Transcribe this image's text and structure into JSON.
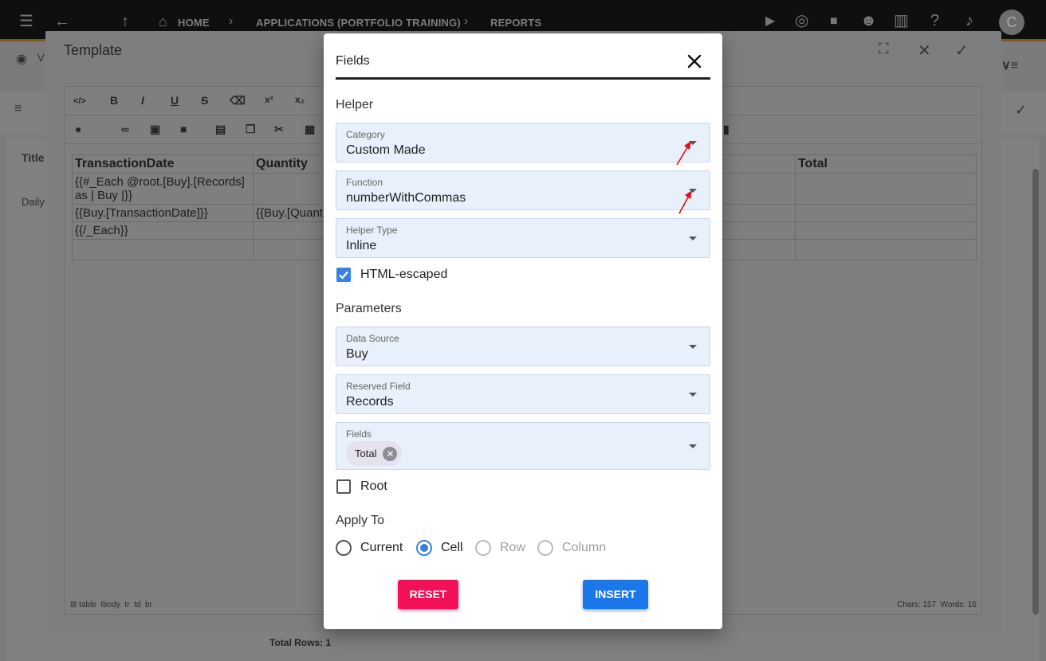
{
  "appbar": {
    "breadcrumb": [
      "HOME",
      "APPLICATIONS (PORTFOLIO TRAINING)",
      "REPORTS"
    ],
    "avatar_letter": "C"
  },
  "background": {
    "view_label": "V",
    "column_title": "Title",
    "row_label": "Daily",
    "total_rows": "Total Rows: 1"
  },
  "template_dialog": {
    "title": "Template",
    "toolbar": {
      "source": "</>",
      "bold": "B",
      "italic": "I",
      "underline": "U",
      "strike": "S",
      "superscript": "x²",
      "subscript": "x₂"
    },
    "table": {
      "headers": [
        "TransactionDate",
        "Quantity",
        "",
        "Total"
      ],
      "rows": [
        [
          "{{#_Each @root.[Buy].[Records] as | Buy |}}",
          "",
          "",
          ""
        ],
        [
          "{{Buy.[TransactionDate]}}",
          "{{Buy.[Quant",
          "",
          ""
        ],
        [
          "{{/_Each}}",
          "",
          "",
          ""
        ],
        [
          "",
          "",
          "",
          ""
        ]
      ]
    },
    "status_path": "table  tbody  tr  td  br",
    "status_counts": "Chars: 157  Words: 16"
  },
  "fields_modal": {
    "title": "Fields",
    "helper_section": "Helper",
    "category": {
      "label": "Category",
      "value": "Custom Made"
    },
    "function": {
      "label": "Function",
      "value": "numberWithCommas"
    },
    "helper_type": {
      "label": "Helper Type",
      "value": "Inline"
    },
    "html_escaped": {
      "label": "HTML-escaped",
      "checked": true
    },
    "parameters_section": "Parameters",
    "data_source": {
      "label": "Data Source",
      "value": "Buy"
    },
    "reserved_field": {
      "label": "Reserved Field",
      "value": "Records"
    },
    "fields": {
      "label": "Fields",
      "chips": [
        "Total"
      ]
    },
    "root": {
      "label": "Root",
      "checked": false
    },
    "apply_to_section": "Apply To",
    "apply_to": {
      "options": [
        "Current",
        "Cell",
        "Row",
        "Column"
      ],
      "selected": "Cell",
      "disabled": [
        "Row",
        "Column"
      ]
    },
    "reset_label": "RESET",
    "insert_label": "INSERT"
  },
  "colors": {
    "accent_blue": "#1b78ea",
    "reset_pink": "#f21059",
    "field_bg": "#e7f0fb",
    "annotation_red": "#e01010"
  }
}
